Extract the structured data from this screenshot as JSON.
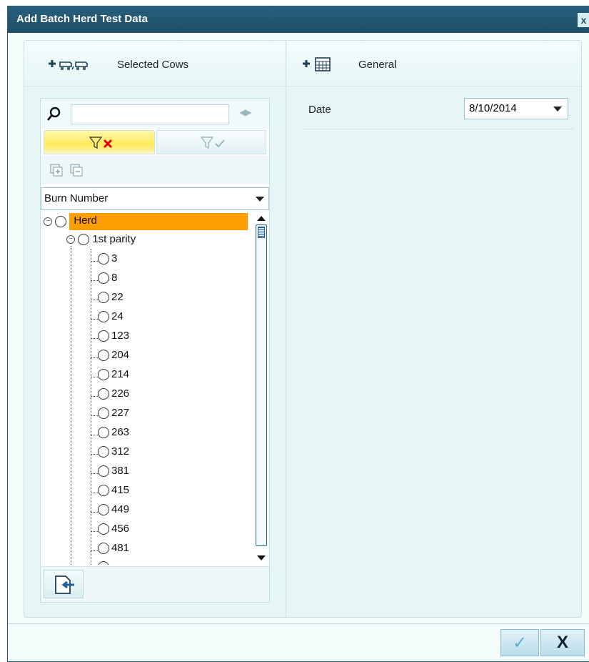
{
  "window": {
    "title": "Add Batch Herd Test Data",
    "close_label": "x"
  },
  "left_panel": {
    "header_label": "Selected Cows",
    "search": {
      "value": "",
      "placeholder": ""
    },
    "sort_by": "Burn Number",
    "tree": {
      "root": "Herd",
      "group": "1st parity",
      "items": [
        "3",
        "8",
        "22",
        "24",
        "123",
        "204",
        "214",
        "226",
        "227",
        "263",
        "312",
        "381",
        "415",
        "449",
        "456",
        "481"
      ]
    }
  },
  "right_panel": {
    "header_label": "General",
    "date_label": "Date",
    "date_value": "8/10/2014"
  },
  "footer": {
    "ok_symbol": "✓",
    "cancel_symbol": "X"
  },
  "colors": {
    "title_bar": "#285f7b",
    "highlight": "#ff9e00",
    "filter_tab_active": "#ffe95a"
  },
  "icons": [
    "add-icon",
    "cows-icon",
    "calendar-icon",
    "search-icon",
    "filter-clear-icon",
    "filter-apply-icon",
    "expand-all-icon",
    "collapse-all-icon",
    "export-icon",
    "check-icon",
    "close-icon"
  ]
}
